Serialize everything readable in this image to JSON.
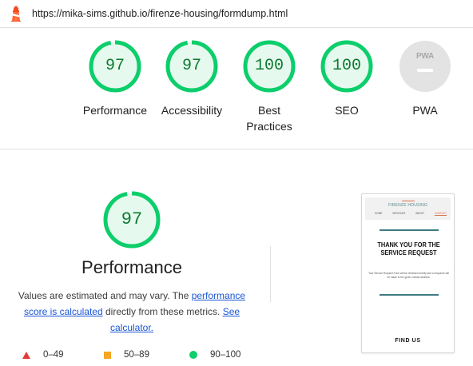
{
  "url": "https://mika-sims.github.io/firenze-housing/formdump.html",
  "colors": {
    "pass": "#0cce6b",
    "pass_text": "#0c7a2f",
    "average": "#f5a623",
    "fail": "#e53935",
    "link": "#1a55d6"
  },
  "categories": [
    {
      "score": 97,
      "label": "Performance"
    },
    {
      "score": 97,
      "label": "Accessibility"
    },
    {
      "score": 100,
      "label": "Best Practices"
    },
    {
      "score": 100,
      "label": "SEO"
    }
  ],
  "pwa": {
    "badge": "PWA",
    "label": "PWA"
  },
  "performance": {
    "score": 97,
    "title": "Performance",
    "desc_part1": "Values are estimated and may vary. The ",
    "link1": "performance score is calculated",
    "desc_part2": " directly from these metrics. ",
    "link2": "See calculator."
  },
  "legend": [
    {
      "shape": "triangle",
      "range": "0–49"
    },
    {
      "shape": "square",
      "range": "50–89"
    },
    {
      "shape": "circle",
      "range": "90–100"
    }
  ],
  "screenshot": {
    "brand": "FIRENZE HOUSING",
    "nav": [
      "HOME",
      "SERVICES",
      "ABOUT",
      "CONTACT"
    ],
    "heading": "THANK YOU FOR THE SERVICE REQUEST",
    "body": "Your Service Request Form will be reviewed shortly and a response will be made to the given contact address.",
    "footer": "FIND US"
  }
}
